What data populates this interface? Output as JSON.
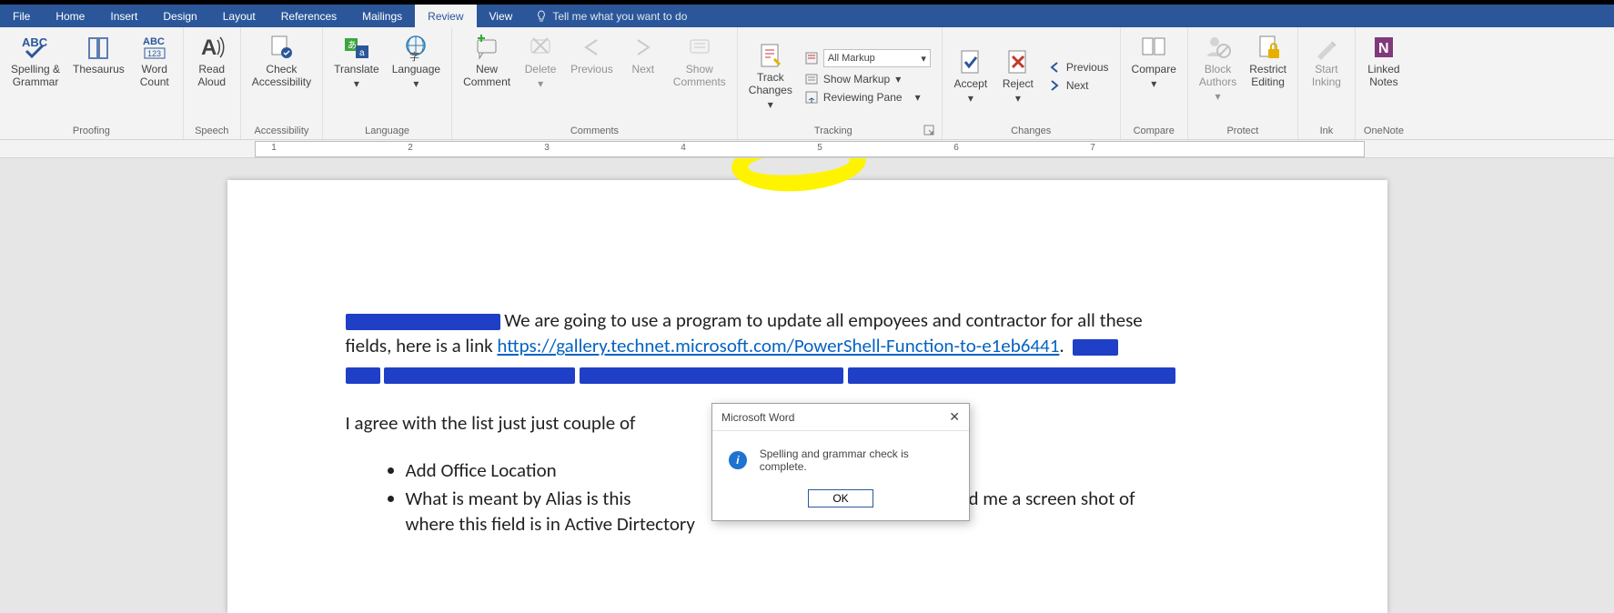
{
  "menu": {
    "file": "File",
    "home": "Home",
    "insert": "Insert",
    "design": "Design",
    "layout": "Layout",
    "references": "References",
    "mailings": "Mailings",
    "review": "Review",
    "view": "View",
    "tell_me": "Tell me what you want to do"
  },
  "ribbon": {
    "proofing": {
      "label": "Proofing",
      "spelling": "Spelling &\nGrammar",
      "thesaurus": "Thesaurus",
      "wordcount": "Word\nCount"
    },
    "speech": {
      "label": "Speech",
      "readaloud": "Read\nAloud"
    },
    "accessibility": {
      "label": "Accessibility",
      "check": "Check\nAccessibility"
    },
    "language": {
      "label": "Language",
      "translate": "Translate",
      "language": "Language"
    },
    "comments": {
      "label": "Comments",
      "new": "New\nComment",
      "delete": "Delete",
      "previous": "Previous",
      "next": "Next",
      "show": "Show\nComments"
    },
    "tracking": {
      "label": "Tracking",
      "track": "Track\nChanges",
      "markup_value": "All Markup",
      "showmarkup": "Show Markup",
      "reviewingpane": "Reviewing Pane"
    },
    "changes": {
      "label": "Changes",
      "accept": "Accept",
      "reject": "Reject",
      "previous": "Previous",
      "next": "Next"
    },
    "compare": {
      "label": "Compare",
      "compare": "Compare"
    },
    "protect": {
      "label": "Protect",
      "block": "Block\nAuthors",
      "restrict": "Restrict\nEditing"
    },
    "ink": {
      "label": "Ink",
      "start": "Start\nInking"
    },
    "onenote": {
      "label": "OneNote",
      "linked": "Linked\nNotes"
    }
  },
  "ruler": {
    "n1": "1",
    "n2": "2",
    "n3": "3",
    "n4": "4",
    "n5": "5",
    "n6": "6",
    "n7": "7"
  },
  "doc": {
    "p1_a": "We are going to use a program to update all empoyees and contractor for all these",
    "p1_b": "fields, here is a link ",
    "link": "https://gallery.technet.microsoft.com/PowerShell-Function-to-e1eb6441",
    "p1_c": ".",
    "p2_a": "I agree with the list just just couple of",
    "b1": "Add Office Location",
    "b2_a": "What is meant by Alias is this",
    "b2_b": "n you send me a screen shot of",
    "b3": "where this field is in Active Dirtectory"
  },
  "dialog": {
    "title": "Microsoft Word",
    "msg": "Spelling and grammar check is complete.",
    "ok": "OK"
  }
}
